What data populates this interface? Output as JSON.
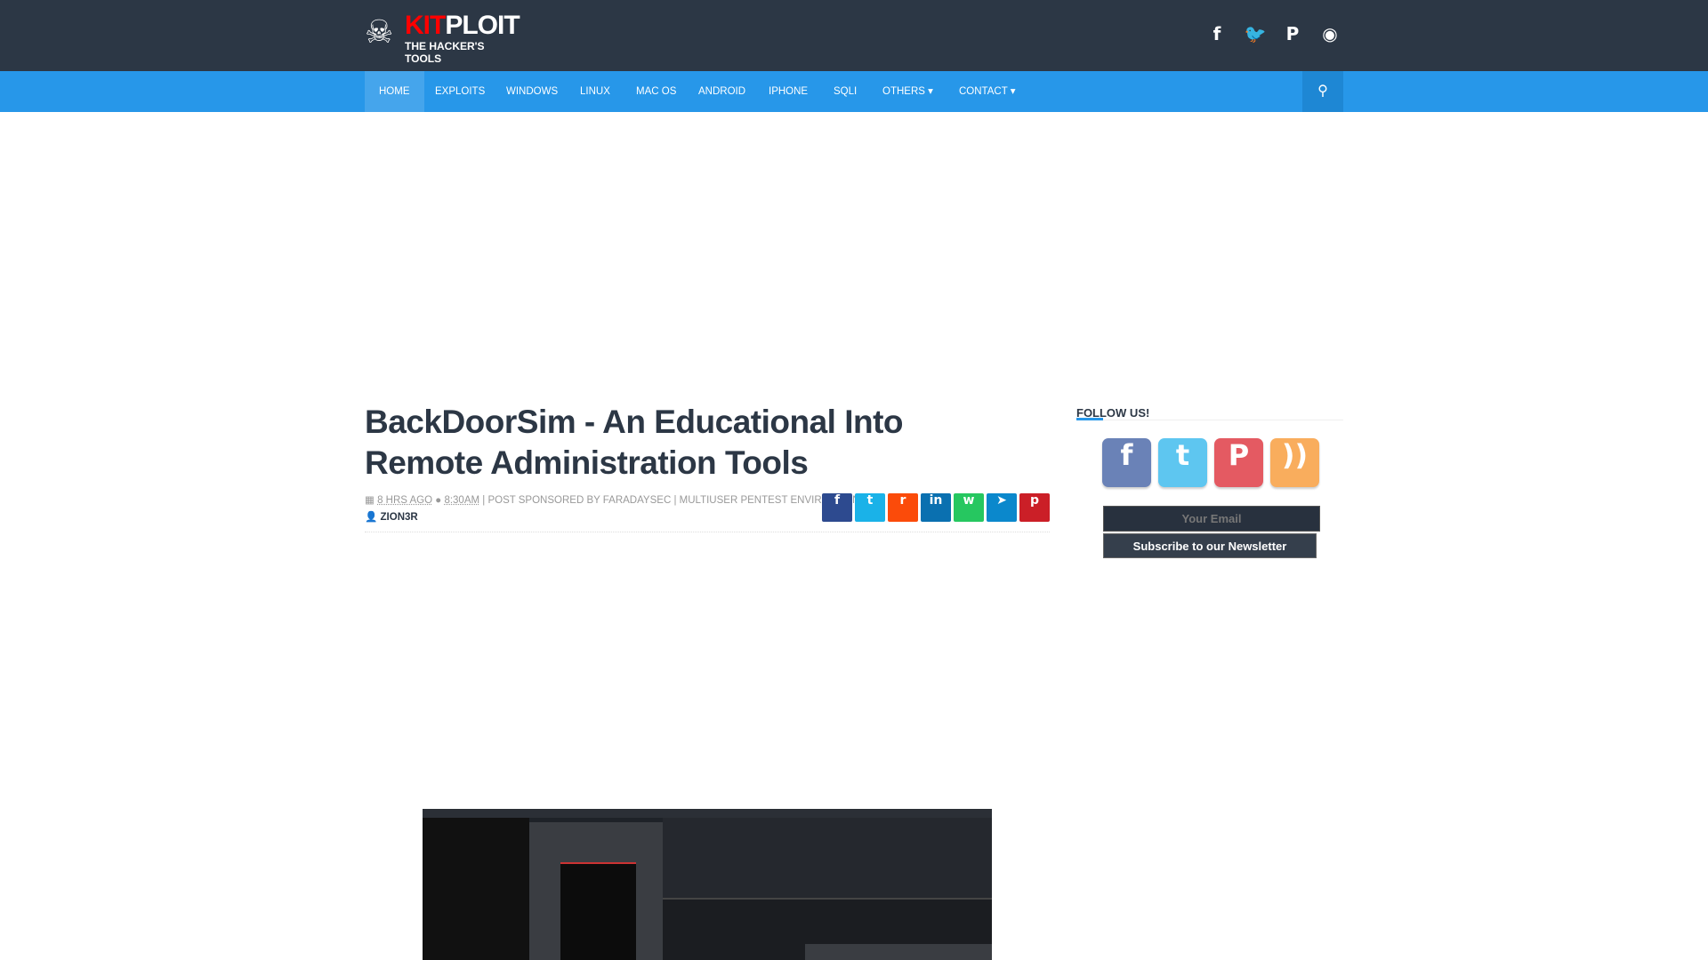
{
  "header": {
    "logo_text": "KITPLOIT",
    "logo_tagline": "THE HACKER'S TOOLS",
    "social": [
      {
        "icon": "facebook-icon",
        "glyph": "f"
      },
      {
        "icon": "twitter-icon",
        "glyph": "🐦"
      },
      {
        "icon": "pinterest-icon",
        "glyph": "P"
      },
      {
        "icon": "rss-icon",
        "glyph": "◉"
      }
    ]
  },
  "nav": {
    "items": [
      "HOME",
      "EXPLOITS",
      "WINDOWS",
      "LINUX",
      "MAC OS",
      "ANDROID",
      "IPHONE",
      "SQLI",
      "OTHERS ▾",
      "CONTACT ▾"
    ],
    "search_icon": "search-icon"
  },
  "post": {
    "title": "BackDoorSim - An Educational Into Remote Administration Tools",
    "time_ago": "8 HRS AGO",
    "time": "8:30AM",
    "sponsor": "POST SPONSORED BY FARADAYSEC",
    "sponsor2": "MULTIUSER PENTEST ENVIRONMENT",
    "author": "ZION3R",
    "share": [
      {
        "icon": "facebook-icon",
        "color": "#2d4a8f",
        "glyph": "f"
      },
      {
        "icon": "twitter-icon",
        "color": "#1ab2e8",
        "glyph": "t"
      },
      {
        "icon": "reddit-icon",
        "color": "#fb4b0a",
        "glyph": "r"
      },
      {
        "icon": "linkedin-icon",
        "color": "#0a70b0",
        "glyph": "in"
      },
      {
        "icon": "whatsapp-icon",
        "color": "#26c760",
        "glyph": "w"
      },
      {
        "icon": "telegram-icon",
        "color": "#0b88cc",
        "glyph": "➤"
      },
      {
        "icon": "pinterest-icon",
        "color": "#cb1f27",
        "glyph": "p"
      }
    ]
  },
  "sidebar": {
    "follow_title": "FOLLOW US!",
    "follow": [
      {
        "icon": "facebook-icon",
        "color": "#6a82b7",
        "glyph": "f"
      },
      {
        "icon": "twitter-icon",
        "color": "#5ec6f0",
        "glyph": "t"
      },
      {
        "icon": "pinterest-icon",
        "color": "#e45a62",
        "glyph": "P"
      },
      {
        "icon": "rss-icon",
        "color": "#f9ad5d",
        "glyph": "))"
      }
    ],
    "email_placeholder": "Your Email",
    "subscribe_label": "Subscribe to our Newsletter"
  }
}
